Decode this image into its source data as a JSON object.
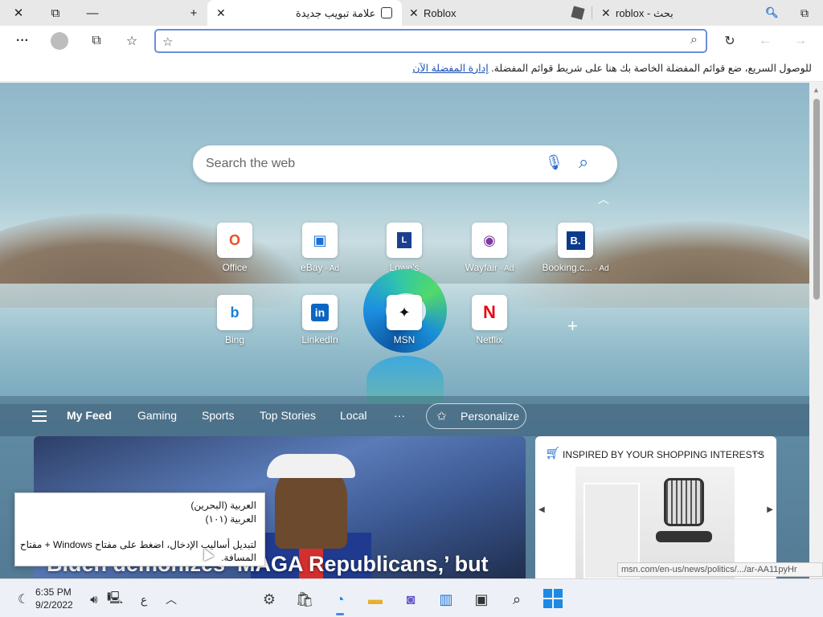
{
  "tabs": [
    {
      "label": "علامة تبويب جديدة",
      "active": true
    },
    {
      "label": "Roblox",
      "active": false
    },
    {
      "label": "roblox - بحث",
      "active": false
    }
  ],
  "address": {
    "value": "",
    "placeholder": ""
  },
  "favbar": {
    "message": "للوصول السريع، ضع قوائم المفضلة الخاصة بك هنا على شريط قوائم المفضلة.",
    "link": "إدارة المفضلة الآن"
  },
  "search": {
    "placeholder": "Search the web"
  },
  "tiles_row1": [
    {
      "label": "Office",
      "ad": "",
      "glyph": "O",
      "color": "#e8502a"
    },
    {
      "label": "eBay",
      "ad": " · Ad",
      "glyph": "▣",
      "color": "#1f6fd3"
    },
    {
      "label": "Lowe's",
      "ad": "",
      "glyph": "L",
      "color": "#1b3f8f"
    },
    {
      "label": "Wayfair",
      "ad": " · Ad",
      "glyph": "◉",
      "color": "#7a3a9e"
    },
    {
      "label": "Booking.c...",
      "ad": " · Ad",
      "glyph": "B.",
      "color": "#0c3b8c"
    }
  ],
  "tiles_row2": [
    {
      "label": "Bing",
      "glyph": "b",
      "color": "#1a7fd6"
    },
    {
      "label": "LinkedIn",
      "glyph": "in",
      "color": "#0a66c2"
    },
    {
      "label": "MSN",
      "glyph": "✦",
      "color": "#111111"
    },
    {
      "label": "Netflix",
      "glyph": "N",
      "color": "#e50914"
    }
  ],
  "feed_nav": {
    "items": [
      "My Feed",
      "Gaming",
      "Sports",
      "Top Stories",
      "Local"
    ],
    "more": "···",
    "personalize": "Personalize"
  },
  "main_card": {
    "headline": "Biden demonizes ‘MAGA Republicans,’ but"
  },
  "side_card": {
    "title": "INSPIRED BY YOUR SHOPPING INTERESTS",
    "more": "···"
  },
  "status_url": "msn.com/en-us/news/politics/.../ar-AA11pyHr",
  "tooltip": {
    "line1": "العربية (البحرين)",
    "line2": "العربية (١٠١)",
    "line3": "لتبديل أساليب الإدخال، اضغط على مفتاح Windows + مفتاح المسافة."
  },
  "taskbar": {
    "time": "6:35 PM",
    "date": "9/2/2022",
    "lang": "ع"
  },
  "colors": {
    "accent": "#2b6bcc",
    "address_border": "#6b8fd6",
    "taskbar_bg": "#edf1f7"
  }
}
